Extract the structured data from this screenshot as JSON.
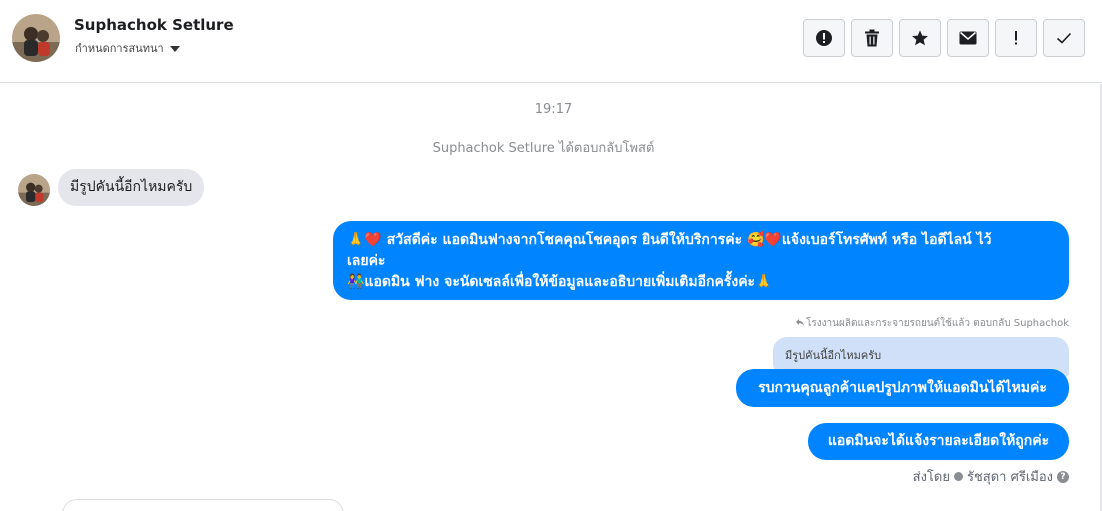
{
  "header": {
    "contact_name": "Suphachok Setlure",
    "subtitle": "กำหนดการสนทนา"
  },
  "toolbar": {
    "buttons": [
      {
        "icon": "alert-circle-icon"
      },
      {
        "icon": "trash-icon"
      },
      {
        "icon": "star-icon"
      },
      {
        "icon": "envelope-icon"
      },
      {
        "icon": "exclamation-icon"
      },
      {
        "icon": "check-icon"
      }
    ]
  },
  "conversation": {
    "time": "19:17",
    "replied_notice": "Suphachok Setlure ได้ตอบกลับโพสต์",
    "incoming": {
      "text": "มีรูปคันนี้อีกไหมครับ"
    },
    "outgoing": [
      {
        "lines": [
          "🙏❤️ สวัสดีค่ะ แอดมินฟางจากโชคคุณโชคอุดร ยินดีให้บริการค่ะ  🥰❤️แจ้งเบอร์โทรศัพท์ หรือ ไอดีไลน์  ไว้",
          "เลยค่ะ",
          "👫แอดมิน ฟาง จะนัดเซลล์เพื่อให้ข้อมูลและอธิบายเพิ่มเติมอีกครั้งค่ะ🙏"
        ]
      },
      {
        "reply_caption": "โรงงานผลิตและกระจายรถยนต์ใช้แล้ว ตอบกลับ Suphachok",
        "quoted": "มีรูปคันนี้อีกไหมครับ",
        "text": "รบกวนคุณลูกค้าแคปรูปภาพให้แอดมินได้ไหมค่ะ"
      },
      {
        "text": "แอดมินจะได้แจ้งรายละเอียดให้ถูกค่ะ"
      }
    ],
    "sent_by": {
      "prefix": "ส่งโดย",
      "name": "รัชสุดา ศรีเมือง",
      "help": "?"
    }
  },
  "colors": {
    "outgoing_bubble": "#0084ff",
    "incoming_bubble": "#e4e6eb",
    "quoted_bubble": "#cfe0f8"
  }
}
